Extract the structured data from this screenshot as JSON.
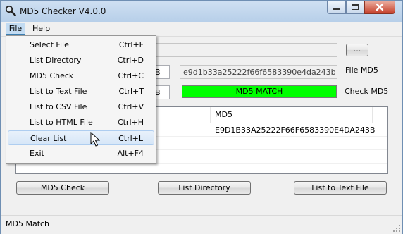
{
  "window": {
    "title": "MD5 Checker V4.0.0"
  },
  "menubar": {
    "file": "File",
    "help": "Help"
  },
  "file_menu": {
    "items": [
      {
        "label": "Select File",
        "shortcut": "Ctrl+F"
      },
      {
        "label": "List Directory",
        "shortcut": "Ctrl+D"
      },
      {
        "label": "MD5 Check",
        "shortcut": "Ctrl+C"
      },
      {
        "label": "List to Text File",
        "shortcut": "Ctrl+T"
      },
      {
        "label": "List to CSV File",
        "shortcut": "Ctrl+V"
      },
      {
        "label": "List to HTML File",
        "shortcut": "Ctrl+H"
      },
      {
        "label": "Clear List",
        "shortcut": "Ctrl+L"
      },
      {
        "label": "Exit",
        "shortcut": "Alt+F4"
      }
    ],
    "highlighted": "Clear List"
  },
  "form": {
    "file_path_value": "",
    "browse_label": "...",
    "left_hash_1_tail": "B",
    "left_hash_2_tail": "B",
    "file_md5_value": "e9d1b33a25222f66f6583390e4da243b",
    "file_md5_label": "File MD5",
    "match_text": "MD5 MATCH",
    "match_color": "#00ff00",
    "check_md5_label": "Check MD5"
  },
  "list": {
    "columns": [
      "",
      "MD5"
    ],
    "rows": [
      {
        "file": "",
        "md5": "E9D1B33A25222F66F6583390E4DA243B"
      }
    ]
  },
  "buttons": {
    "md5_check": "MD5 Check",
    "list_directory": "List Directory",
    "list_to_text": "List to Text File"
  },
  "status": {
    "text": "MD5 Match"
  }
}
